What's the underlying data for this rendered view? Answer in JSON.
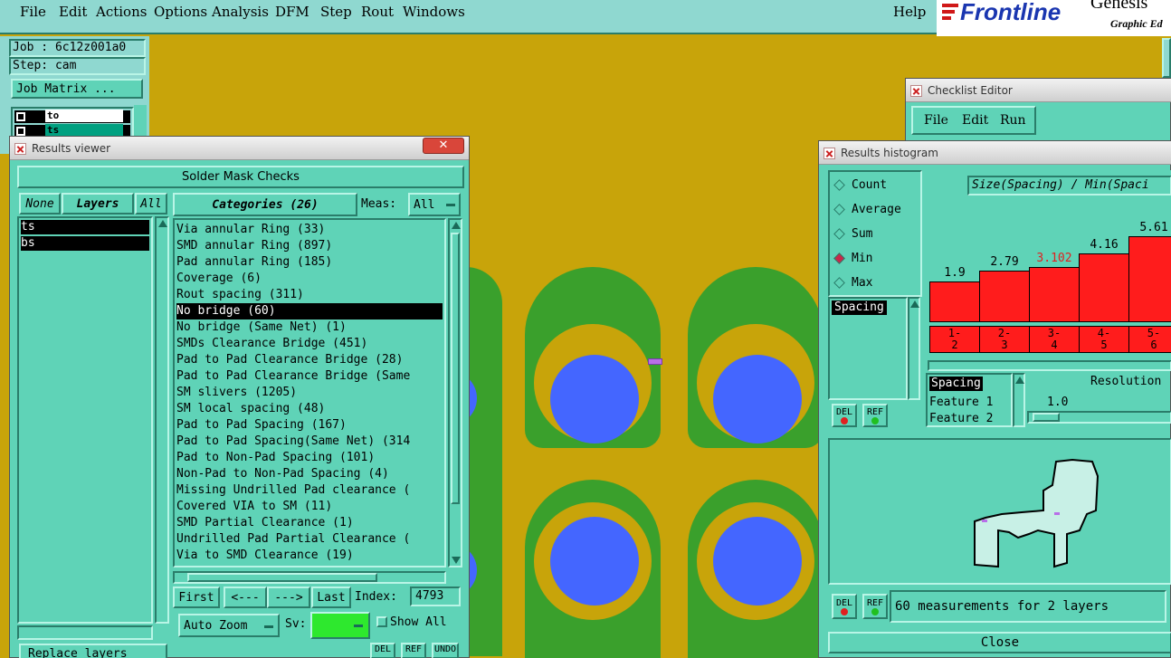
{
  "menubar": {
    "items": [
      "File",
      "Edit",
      "Actions",
      "Options",
      "Analysis",
      "DFM",
      "Step",
      "Rout",
      "Windows"
    ],
    "help": "Help"
  },
  "branding": {
    "logo": "Frontline",
    "product": "Genesis",
    "subtitle": "Graphic Ed"
  },
  "job_panel": {
    "job": "Job : 6c12z001a0",
    "step": "Step: cam",
    "job_matrix_button": "Job Matrix ...",
    "layers": [
      {
        "name": "to",
        "selected": true
      },
      {
        "name": "ts",
        "selected": false
      }
    ]
  },
  "results_viewer": {
    "title": "Results viewer",
    "header": "Solder Mask Checks",
    "none_button": "None",
    "layers_button": "Layers",
    "all_button": "All",
    "layer_list": [
      "ts",
      "bs"
    ],
    "categories_button": "Categories (26)",
    "meas_label": "Meas:",
    "meas_value": "All",
    "categories": [
      "Via annular Ring (33)",
      "SMD annular Ring (897)",
      "Pad annular Ring (185)",
      "Coverage (6)",
      "Rout spacing (311)",
      "No bridge (60)",
      "No bridge (Same Net) (1)",
      "SMDs Clearance Bridge (451)",
      "Pad to Pad Clearance Bridge (28)",
      "Pad to Pad Clearance Bridge (Same",
      "SM slivers (1205)",
      "SM local spacing (48)",
      "Pad to Pad Spacing (167)",
      "Pad to Pad Spacing(Same Net) (314",
      "Pad to Non-Pad Spacing (101)",
      "Non-Pad to Non-Pad Spacing (4)",
      "Missing Undrilled Pad clearance (",
      "Covered VIA to SM (11)",
      "SMD Partial Clearance (1)",
      "Undrilled Pad Partial Clearance (",
      "Via to SMD Clearance (19)"
    ],
    "selected_category_index": 5,
    "first_button": "First",
    "prev_button": "<---",
    "next_button": "--->",
    "last_button": "Last",
    "index_label": "Index:",
    "index_value": "4793",
    "auto_zoom": "Auto Zoom",
    "sv_label": "Sv:",
    "show_all": "Show All",
    "replace_layers": "Replace layers",
    "del": "DEL",
    "ref": "REF",
    "undo": "UNDO"
  },
  "checklist_editor": {
    "title": "Checklist Editor",
    "menu": [
      "File",
      "Edit",
      "Run"
    ]
  },
  "histogram": {
    "title": "Results histogram",
    "modes": [
      {
        "label": "Count",
        "selected": false
      },
      {
        "label": "Average",
        "selected": false
      },
      {
        "label": "Sum",
        "selected": false
      },
      {
        "label": "Min",
        "selected": true
      },
      {
        "label": "Max",
        "selected": false
      }
    ],
    "measure_list": [
      "Spacing"
    ],
    "chart_label": "Size(Spacing) / Min(Spaci",
    "bars": [
      {
        "value": "1.9",
        "bin": "1-\n2",
        "highlight": false
      },
      {
        "value": "2.79",
        "bin": "2-\n3",
        "highlight": false
      },
      {
        "value": "3.102",
        "bin": "3-\n4",
        "highlight": true
      },
      {
        "value": "4.16",
        "bin": "4-\n5",
        "highlight": false
      },
      {
        "value": "5.61",
        "bin": "5-\n6",
        "highlight": false
      }
    ],
    "field_list": [
      "Spacing",
      "Feature 1",
      "Feature 2"
    ],
    "resolution_label": "Resolution",
    "resolution_value": "1.0",
    "status": "60 measurements for 2 layers",
    "close": "Close",
    "del": "DEL",
    "ref": "REF",
    "colors": {
      "bar": "#ff1c1c",
      "highlight_text": "#e02020",
      "panel": "#5fd3b7"
    }
  }
}
